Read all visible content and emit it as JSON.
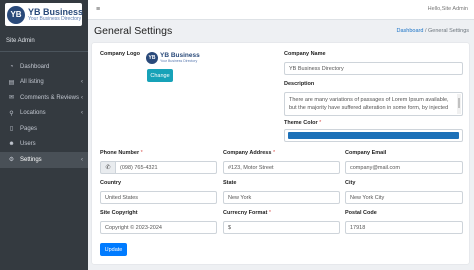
{
  "sidebar": {
    "brand_title": "YB Business",
    "brand_sub": "Your Business Directory",
    "logo_letters": "YB",
    "user": "Site Admin",
    "items": [
      {
        "label": "Dashboard",
        "icon": "dashboard-icon",
        "glyph": "◔"
      },
      {
        "label": "All listing",
        "icon": "list-icon",
        "glyph": "▤",
        "caret": "‹"
      },
      {
        "label": "Comments & Reviews",
        "icon": "comments-icon",
        "glyph": "✉",
        "caret": "‹"
      },
      {
        "label": "Locations",
        "icon": "location-pin-icon",
        "glyph": "⚲",
        "caret": "‹"
      },
      {
        "label": "Pages",
        "icon": "page-icon",
        "glyph": "▯"
      },
      {
        "label": "Users",
        "icon": "user-icon",
        "glyph": "☻"
      },
      {
        "label": "Settings",
        "icon": "gear-icon",
        "glyph": "⚙",
        "caret": "‹",
        "active": true
      }
    ]
  },
  "topbar": {
    "menu_icon": "≡",
    "greeting": "Hello,Site Admin"
  },
  "header": {
    "title": "General Settings",
    "breadcrumb": [
      "Dashboard",
      "/",
      "General Settings"
    ]
  },
  "form": {
    "company_logo": {
      "label": "Company Logo",
      "logo_title": "YB Business",
      "logo_sub": "Your Business Directory",
      "change_label": "Change"
    },
    "company_name": {
      "label": "Company Name",
      "value": "YB Business Directory"
    },
    "description": {
      "label": "Description",
      "value": "There are many variations of passages of Lorem Ipsum available, but the majority have suffered alteration in some form, by injected"
    },
    "theme_color": {
      "label": "Theme Color",
      "required": "*",
      "value": "#1d71b8"
    },
    "phone": {
      "label": "Phone Number",
      "required": "*",
      "value": "(098) 765-4321",
      "icon": "phone-icon",
      "glyph": "✆"
    },
    "address": {
      "label": "Company Address",
      "required": "*",
      "value": "#123, Motor Street"
    },
    "email": {
      "label": "Company Email",
      "value": "company@mail.com"
    },
    "country": {
      "label": "Country",
      "value": "United States"
    },
    "state": {
      "label": "State",
      "value": "New York"
    },
    "city": {
      "label": "City",
      "value": "New York City"
    },
    "copyright": {
      "label": "Site Copyright",
      "value": "Copyright © 2023-2024"
    },
    "currency": {
      "label": "Currecny Format",
      "required": "*",
      "value": "$"
    },
    "postal": {
      "label": "Postal Code",
      "value": "17918"
    },
    "update_label": "Update"
  }
}
